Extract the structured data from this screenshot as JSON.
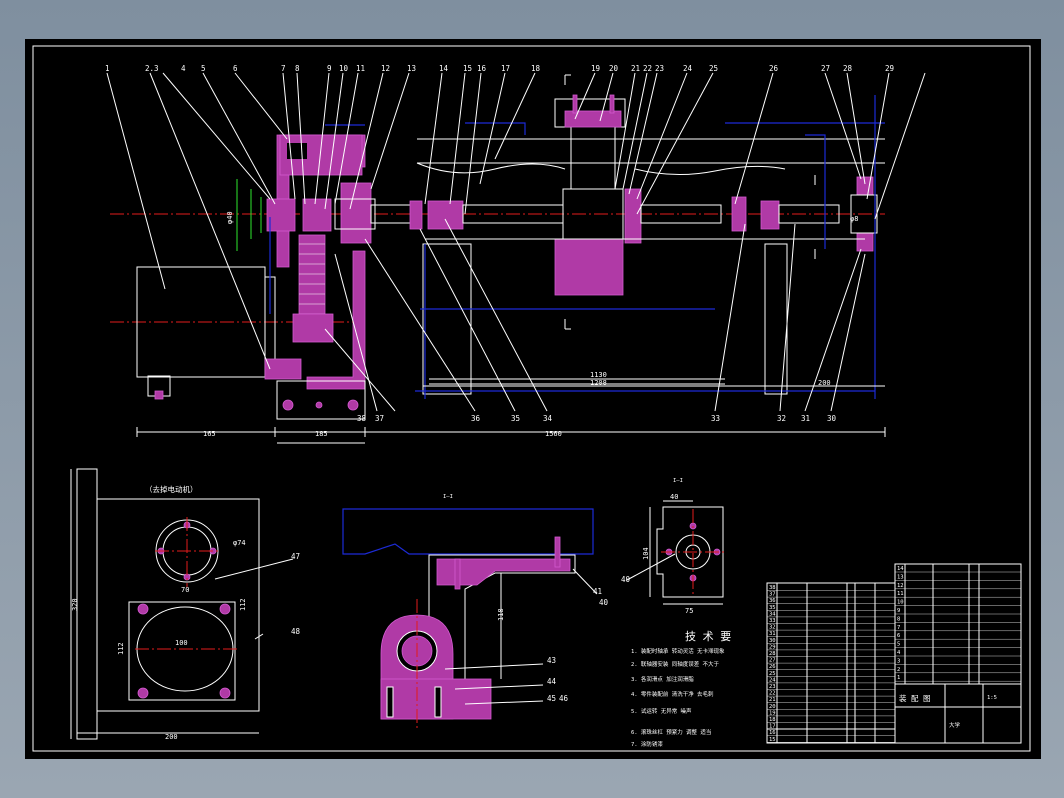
{
  "drawing": {
    "balloons_top": [
      "1",
      "2.3",
      "4",
      "5",
      "6",
      "7",
      "8",
      "9",
      "10",
      "11",
      "12",
      "13",
      "14",
      "15",
      "16",
      "17",
      "18",
      "19",
      "20",
      "21",
      "22",
      "23",
      "24",
      "25",
      "26",
      "27",
      "28",
      "29"
    ],
    "balloons_bottom": [
      "38",
      "37",
      "36",
      "35",
      "34",
      "33",
      "32",
      "31",
      "30"
    ],
    "balloons_lower": [
      "47",
      "48",
      "43",
      "44",
      "45",
      "46",
      "41",
      "42",
      "40"
    ],
    "dimensions": {
      "d_overall": "1560",
      "d_mid1": "1130",
      "d_mid2": "1208",
      "d_right": "200",
      "d_base": "185",
      "d_left": "165",
      "d_section_height": "118",
      "d_plate_height": "320",
      "d_plate_width": "200",
      "d_bore_dia": "φ74",
      "d_bore_pitch": "70",
      "d_hole_pitch": "112",
      "d_hole_pitch_v": "112",
      "d_hole_width": "100",
      "d_flange_w": "40",
      "d_flange_h": "104",
      "d_flange_base": "75",
      "d_shaft_dia": "φ8",
      "d_left_dia": "φ40"
    },
    "view_labels": {
      "section": "I—I",
      "section_b": "I—I",
      "plate_title": "（去掉电动机）"
    },
    "notes": {
      "title": "技 术 要",
      "lines": [
        "1. 装配时轴承 转动灵活 无卡滞现象",
        "2. 联轴器安装 同轴度误差 不大于",
        "3. 各润滑点 加注润滑脂",
        "4. 零件装配前 清洗干净 去毛刺",
        "5. 试运转 无异常 噪声",
        "6. 滚珠丝杠 预紧力 调整 适当",
        "7. 涂防锈漆"
      ]
    },
    "bom_left": [
      "38",
      "37",
      "36",
      "35",
      "34",
      "33",
      "32",
      "31",
      "30",
      "29",
      "28",
      "27",
      "26",
      "25",
      "24",
      "23",
      "22",
      "21",
      "20",
      "19",
      "18",
      "17",
      "16",
      "15"
    ],
    "bom_right": [
      "14",
      "13",
      "12",
      "11",
      "10",
      "9",
      "8",
      "7",
      "6",
      "5",
      "4",
      "3",
      "2",
      "1"
    ],
    "title_block": {
      "name": "装 配 图",
      "sub": "大学",
      "scale": "1:5"
    }
  }
}
